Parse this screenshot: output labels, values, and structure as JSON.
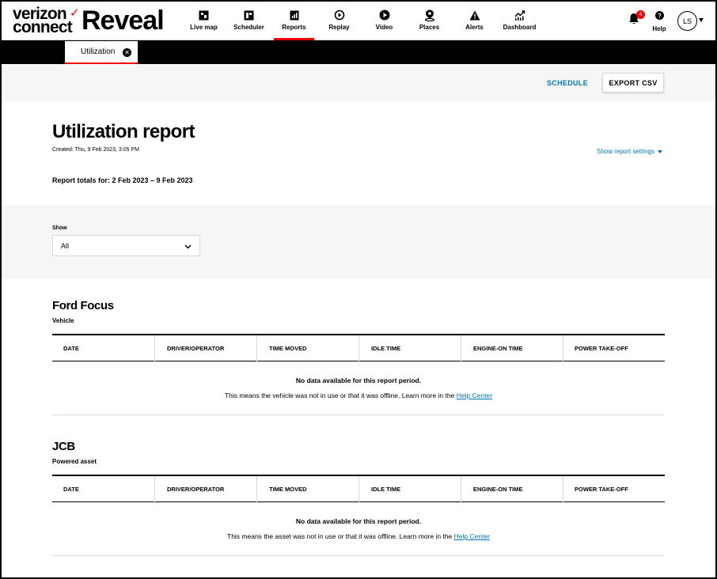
{
  "brand": {
    "logo_line1": "verizon",
    "logo_line2": "connect",
    "logo_check": "✓",
    "product": "Reveal",
    "accent_color": "#ee0000",
    "link_color": "#0077b4"
  },
  "nav": {
    "items": [
      {
        "label": "Live map",
        "icon": "live-map-icon"
      },
      {
        "label": "Scheduler",
        "icon": "scheduler-icon"
      },
      {
        "label": "Reports",
        "icon": "reports-icon",
        "active": true
      },
      {
        "label": "Replay",
        "icon": "replay-icon"
      },
      {
        "label": "Video",
        "icon": "video-icon"
      },
      {
        "label": "Places",
        "icon": "places-icon"
      },
      {
        "label": "Alerts",
        "icon": "alerts-icon"
      },
      {
        "label": "Dashboard",
        "icon": "dashboard-icon"
      }
    ],
    "notifications_count": "4",
    "help_label": "Help",
    "user_initials": "LS"
  },
  "tabs": {
    "active_label": "Utilization"
  },
  "actions": {
    "schedule_label": "SCHEDULE",
    "export_label": "EXPORT CSV"
  },
  "report": {
    "title": "Utilization report",
    "created": "Created: Thu, 9 Feb 2023, 3:05 PM",
    "settings_label": "Show report settings",
    "totals": "Report totals for: 2 Feb 2023 – 9 Feb 2023"
  },
  "filter": {
    "label": "Show",
    "selected": "All"
  },
  "columns": [
    "DATE",
    "DRIVER/OPERATOR",
    "TIME MOVED",
    "IDLE TIME",
    "ENGINE-ON TIME",
    "POWER TAKE-OFF"
  ],
  "sections": [
    {
      "name": "Ford Focus",
      "type": "Vehicle",
      "nodata_title": "No data available for this report period.",
      "nodata_text": "This means the vehicle was not in use or that it was offline. Learn more in the ",
      "link_label": "Help Center"
    },
    {
      "name": "JCB",
      "type": "Powered asset",
      "nodata_title": "No data available for this report period.",
      "nodata_text": "This means the asset was not in use or that it was offline. Learn more in the ",
      "link_label": "Help Center"
    }
  ]
}
